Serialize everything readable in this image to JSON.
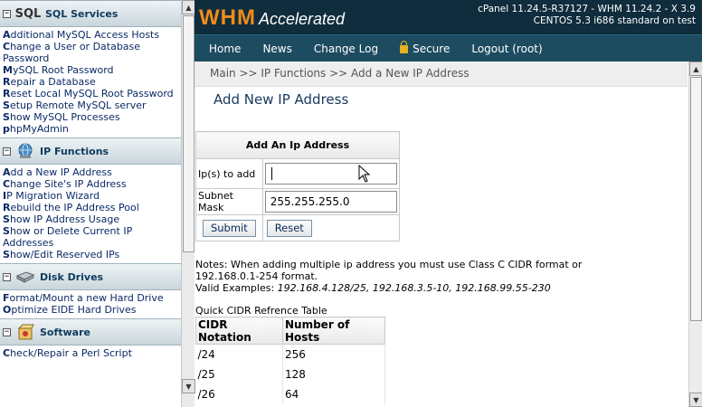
{
  "sidebar": {
    "sections": [
      {
        "title": "SQL Services",
        "icon_label": "SQL",
        "links": [
          {
            "first": "A",
            "rest": "dditional MySQL Access Hosts"
          },
          {
            "first": "C",
            "rest": "hange a User or Database Password"
          },
          {
            "first": "M",
            "rest": "ySQL Root Password"
          },
          {
            "first": "R",
            "rest": "epair a Database"
          },
          {
            "first": "R",
            "rest": "eset Local MySQL Root Password"
          },
          {
            "first": "S",
            "rest": "etup Remote MySQL server"
          },
          {
            "first": "S",
            "rest": "how MySQL Processes"
          },
          {
            "first": "p",
            "rest": "hpMyAdmin"
          }
        ]
      },
      {
        "title": "IP Functions",
        "links": [
          {
            "first": "A",
            "rest": "dd a New IP Address"
          },
          {
            "first": "C",
            "rest": "hange Site's IP Address"
          },
          {
            "first": "I",
            "rest": "P Migration Wizard"
          },
          {
            "first": "R",
            "rest": "ebuild the IP Address Pool"
          },
          {
            "first": "S",
            "rest": "how IP Address Usage"
          },
          {
            "first": "S",
            "rest": "how or Delete Current IP Addresses"
          },
          {
            "first": "S",
            "rest": "how/Edit Reserved IPs"
          }
        ]
      },
      {
        "title": "Disk Drives",
        "links": [
          {
            "first": "F",
            "rest": "ormat/Mount a new Hard Drive"
          },
          {
            "first": "O",
            "rest": "ptimize EIDE Hard Drives"
          }
        ]
      },
      {
        "title": "Software",
        "links": [
          {
            "first": "C",
            "rest": "heck/Repair a Perl Script"
          }
        ]
      }
    ]
  },
  "header": {
    "logo_main": "WHM",
    "logo_sub": "Accelerated",
    "version_line1": "cPanel 11.24.5-R37127 - WHM 11.24.2 - X 3.9",
    "version_line2": "CENTOS 5.3 i686 standard on test"
  },
  "nav": {
    "home": "Home",
    "news": "News",
    "changelog": "Change Log",
    "secure": "Secure",
    "logout": "Logout (root)"
  },
  "breadcrumb": "Main >> IP Functions >> Add a New IP Address",
  "page_title": "Add New IP Address",
  "form": {
    "heading": "Add An Ip Address",
    "ips_label": "Ip(s) to add",
    "ips_value": "",
    "subnet_label": "Subnet Mask",
    "subnet_value": "255.255.255.0",
    "submit": "Submit",
    "reset": "Reset"
  },
  "notes": {
    "line1": "Notes: When adding multiple ip address you must use Class C CIDR format or",
    "line2": "192.168.0.1-254 format.",
    "examples_label": "Valid Examples: ",
    "examples": "192.168.4.128/25, 192.168.3.5-10, 192.168.99.55-230"
  },
  "cidr_table": {
    "caption": "Quick CIDR Refrence Table",
    "headers": [
      "CIDR Notation",
      "Number of Hosts"
    ],
    "rows": [
      [
        "/24",
        "256"
      ],
      [
        "/25",
        "128"
      ],
      [
        "/26",
        "64"
      ]
    ]
  }
}
